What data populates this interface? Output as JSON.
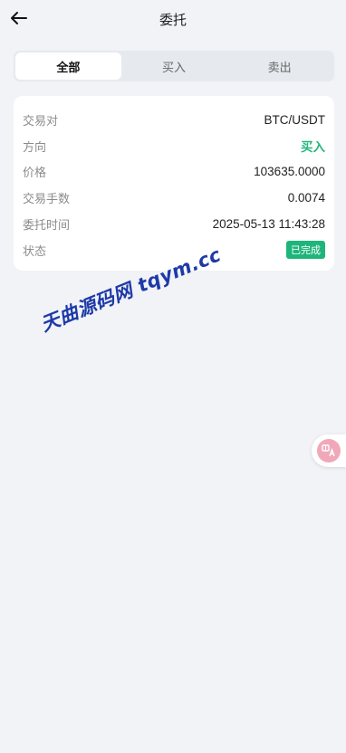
{
  "header": {
    "title": "委托",
    "back_icon": "arrow-left-icon"
  },
  "tabs": [
    {
      "label": "全部",
      "active": true
    },
    {
      "label": "买入",
      "active": false
    },
    {
      "label": "卖出",
      "active": false
    }
  ],
  "order": {
    "pair_label": "交易对",
    "pair_value": "BTC/USDT",
    "direction_label": "方向",
    "direction_value": "买入",
    "price_label": "价格",
    "price_value": "103635.0000",
    "qty_label": "交易手数",
    "qty_value": "0.0074",
    "time_label": "委托时间",
    "time_value": "2025-05-13 11:43:28",
    "status_label": "状态",
    "status_value": "已完成"
  },
  "watermark": "天曲源码网 tqym.cc",
  "floating_button": {
    "icon": "translate-icon"
  },
  "colors": {
    "buy": "#23b77a",
    "status_badge": "#1fb57a",
    "background": "#f1f3f6"
  }
}
